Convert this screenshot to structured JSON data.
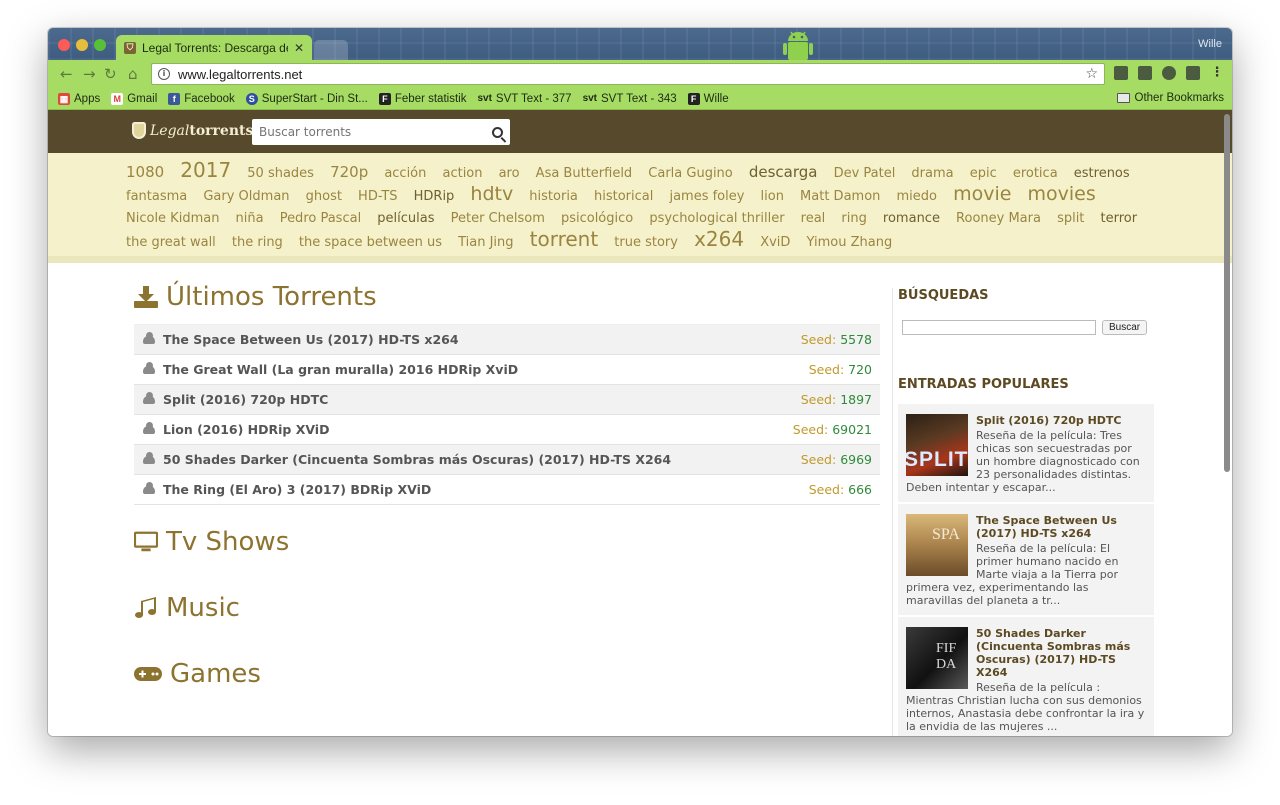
{
  "browser": {
    "tab_title": "Legal Torrents: Descarga de To",
    "tab_close": "✕",
    "profile_name": "Wille",
    "url": "www.legaltorrents.net",
    "accent": "#a6dc63",
    "bookmarks": [
      {
        "label": "Apps",
        "icon": "apps-grid-icon"
      },
      {
        "label": "Gmail",
        "icon": "gmail-icon"
      },
      {
        "label": "Facebook",
        "icon": "facebook-icon"
      },
      {
        "label": "SuperStart - Din St...",
        "icon": "superstart-icon"
      },
      {
        "label": "Feber statistik",
        "icon": "feber-icon"
      },
      {
        "label": "SVT Text - 377",
        "icon": "svt-icon"
      },
      {
        "label": "SVT Text - 343",
        "icon": "svt-icon"
      },
      {
        "label": "Wille",
        "icon": "feber-icon"
      }
    ],
    "bm_svt_prefix": "svt",
    "other_bookmarks": "Other Bookmarks"
  },
  "site": {
    "logo_script": "Legal",
    "logo_bold": "torrents",
    "search_placeholder": "Buscar torrents",
    "header_color": "#574a2c"
  },
  "tags": [
    {
      "label": "1080",
      "size": "t2"
    },
    {
      "label": "2017",
      "size": "t4"
    },
    {
      "label": "50 shades",
      "size": "t1"
    },
    {
      "label": "720p",
      "size": "t2"
    },
    {
      "label": "acción",
      "size": "t1"
    },
    {
      "label": "action",
      "size": "t1"
    },
    {
      "label": "aro",
      "size": "t1"
    },
    {
      "label": "Asa Butterfield",
      "size": "t1"
    },
    {
      "label": "Carla Gugino",
      "size": "t1"
    },
    {
      "label": "descarga",
      "size": "t2",
      "dark": true
    },
    {
      "label": "Dev Patel",
      "size": "t1"
    },
    {
      "label": "drama",
      "size": "t1"
    },
    {
      "label": "epic",
      "size": "t1"
    },
    {
      "label": "erotica",
      "size": "t1"
    },
    {
      "label": "estrenos",
      "size": "t1",
      "dark": true
    },
    {
      "label": "fantasma",
      "size": "t1"
    },
    {
      "label": "Gary Oldman",
      "size": "t1"
    },
    {
      "label": "ghost",
      "size": "t1"
    },
    {
      "label": "HD-TS",
      "size": "t1"
    },
    {
      "label": "HDRip",
      "size": "t1",
      "dark": true
    },
    {
      "label": "hdtv",
      "size": "t3"
    },
    {
      "label": "historia",
      "size": "t1"
    },
    {
      "label": "historical",
      "size": "t1"
    },
    {
      "label": "james foley",
      "size": "t1"
    },
    {
      "label": "lion",
      "size": "t1"
    },
    {
      "label": "Matt Damon",
      "size": "t1"
    },
    {
      "label": "miedo",
      "size": "t1"
    },
    {
      "label": "movie",
      "size": "t3"
    },
    {
      "label": "movies",
      "size": "t3"
    },
    {
      "label": "Nicole Kidman",
      "size": "t1"
    },
    {
      "label": "niña",
      "size": "t1"
    },
    {
      "label": "Pedro Pascal",
      "size": "t1"
    },
    {
      "label": "películas",
      "size": "t1",
      "dark": true
    },
    {
      "label": "Peter Chelsom",
      "size": "t1"
    },
    {
      "label": "psicológico",
      "size": "t1"
    },
    {
      "label": "psychological thriller",
      "size": "t1"
    },
    {
      "label": "real",
      "size": "t1"
    },
    {
      "label": "ring",
      "size": "t1"
    },
    {
      "label": "romance",
      "size": "t1",
      "dark": true
    },
    {
      "label": "Rooney Mara",
      "size": "t1"
    },
    {
      "label": "split",
      "size": "t1"
    },
    {
      "label": "terror",
      "size": "t1",
      "dark": true
    },
    {
      "label": "the great wall",
      "size": "t1"
    },
    {
      "label": "the ring",
      "size": "t1"
    },
    {
      "label": "the space between us",
      "size": "t1"
    },
    {
      "label": "Tian Jing",
      "size": "t1"
    },
    {
      "label": "torrent",
      "size": "t4"
    },
    {
      "label": "true story",
      "size": "t1"
    },
    {
      "label": "x264",
      "size": "t4"
    },
    {
      "label": "XviD",
      "size": "t1"
    },
    {
      "label": "Yimou Zhang",
      "size": "t1"
    }
  ],
  "main": {
    "latest_title": "Últimos Torrents",
    "seed_label": "Seed:",
    "torrents": [
      {
        "title": "The Space Between Us (2017) HD-TS x264",
        "seed": "5578"
      },
      {
        "title": "The Great Wall (La gran muralla) 2016 HDRip XviD",
        "seed": "720"
      },
      {
        "title": "Split (2016) 720p HDTC",
        "seed": "1897"
      },
      {
        "title": "Lion (2016) HDRip XViD",
        "seed": "69021"
      },
      {
        "title": "50 Shades Darker (Cincuenta Sombras más Oscuras) (2017) HD-TS X264",
        "seed": "6969"
      },
      {
        "title": "The Ring (El Aro) 3 (2017) BDRip XViD",
        "seed": "666"
      }
    ],
    "tv_title": "Tv Shows",
    "music_title": "Music",
    "games_title": "Games"
  },
  "sidebar": {
    "search_heading": "BÚSQUEDAS",
    "search_button": "Buscar",
    "popular_heading": "ENTRADAS POPULARES",
    "popular": [
      {
        "title": "Split (2016) 720p HDTC",
        "desc": "Reseña de la película: Tres chicas son secuestradas por un hombre diagnosticado con 23 personalidades distintas. Deben intentar y escapar...",
        "thumb_text": "SPLIT"
      },
      {
        "title": "The Space Between Us (2017) HD-TS x264",
        "desc": "Reseña de la película: El primer humano nacido en Marte viaja a la Tierra por primera vez, experimentando las maravillas del planeta a tr...",
        "thumb_text": "SPA"
      },
      {
        "title": "50 Shades Darker (Cincuenta Sombras más Oscuras) (2017) HD-TS X264",
        "desc": "Reseña de la película : Mientras Christian lucha con sus demonios internos, Anastasia debe confrontar la ira y la envidia de las mujeres ...",
        "thumb_text": "FIF DA"
      }
    ]
  }
}
